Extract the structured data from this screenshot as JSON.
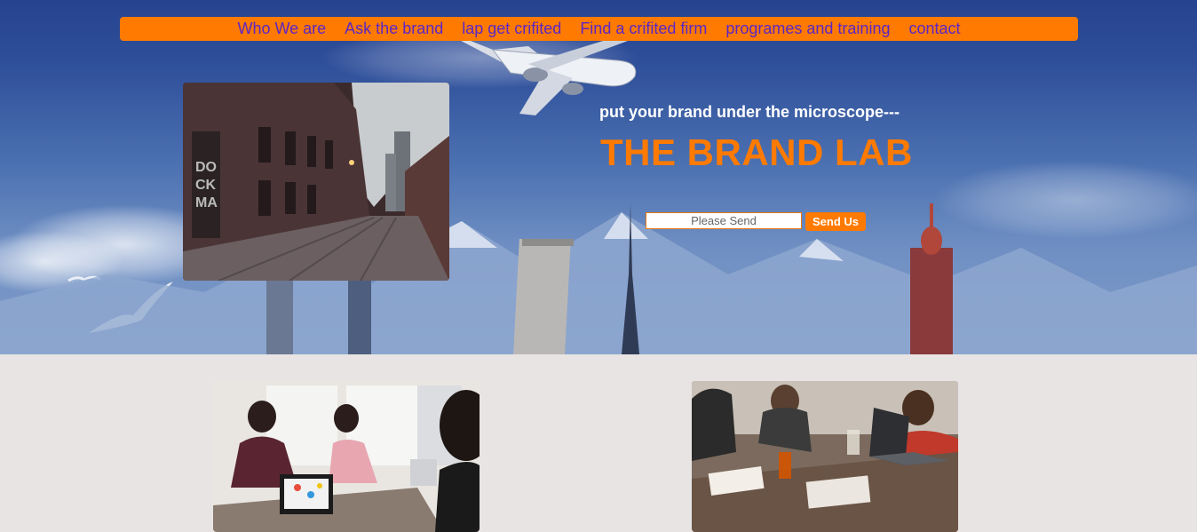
{
  "nav": {
    "items": [
      {
        "label": "Who We are"
      },
      {
        "label": "Ask the brand"
      },
      {
        "label": "lap get crifited"
      },
      {
        "label": "Find a crifited firm"
      },
      {
        "label": "programes and training"
      },
      {
        "label": "contact"
      }
    ]
  },
  "hero": {
    "tagline": "put your brand under the microscope---",
    "title": "THE BRAND LAB",
    "form": {
      "placeholder": "Please Send",
      "value": "",
      "button_label": "Send Us"
    }
  },
  "colors": {
    "accent": "#ff7a00",
    "nav_link": "#5b27c4",
    "sky": "#2f4f9a",
    "section_bg": "#e8e4e3"
  },
  "images": {
    "street": "street-photo",
    "meeting": "meeting-photo",
    "desk": "desk-photo"
  }
}
